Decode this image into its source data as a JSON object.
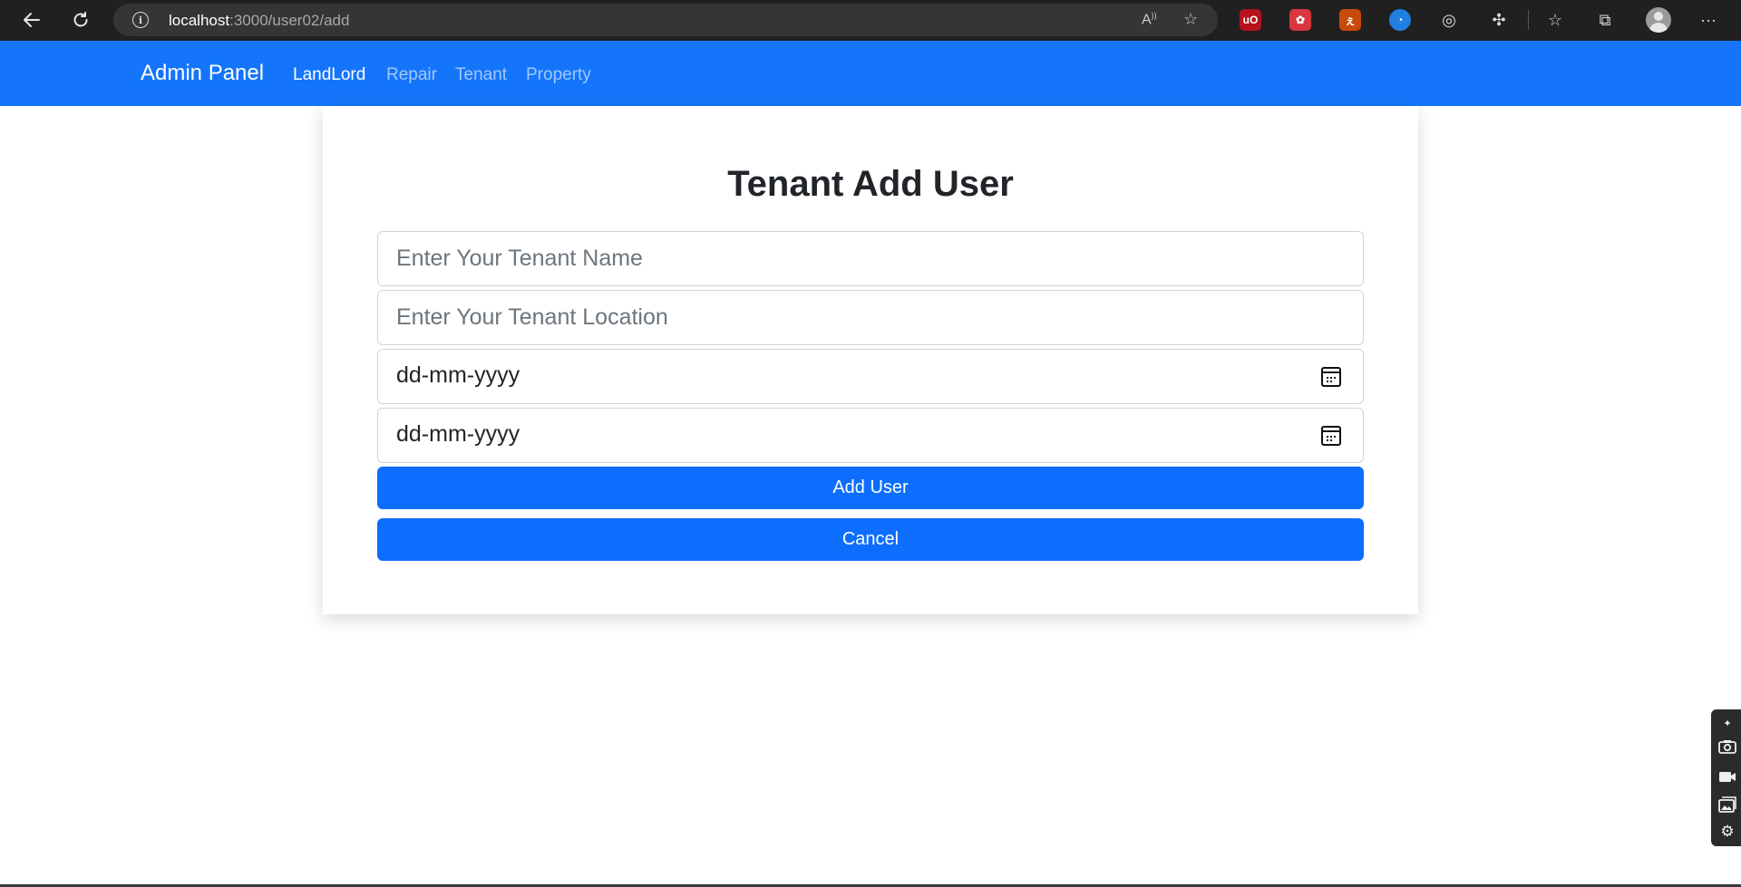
{
  "browser": {
    "url_host": "localhost",
    "url_path": ":3000/user02/add",
    "icons": {
      "back": "arrow-left",
      "reload": "reload",
      "info": "i",
      "read_aloud": "A",
      "favorite_add": "star-plus"
    },
    "extensions": [
      {
        "name": "ublock-origin",
        "color": "#b5121b",
        "glyph": "uO"
      },
      {
        "name": "extension-red",
        "color": "#d8373f",
        "glyph": "✿"
      },
      {
        "name": "extension-orange",
        "color": "#c84a0c",
        "glyph": "ぇ"
      },
      {
        "name": "extension-blue",
        "color": "#1e7fe0",
        "glyph": "◔"
      },
      {
        "name": "extension-target",
        "color": "#202020",
        "glyph": "◎"
      }
    ]
  },
  "navbar": {
    "brand": "Admin Panel",
    "links": [
      {
        "label": "LandLord",
        "active": true
      },
      {
        "label": "Repair",
        "active": false
      },
      {
        "label": "Tenant",
        "active": false
      },
      {
        "label": "Property",
        "active": false
      }
    ]
  },
  "form": {
    "title": "Tenant Add User",
    "name_placeholder": "Enter Your Tenant Name",
    "location_placeholder": "Enter Your Tenant Location",
    "date1": "dd-mm-yyyy",
    "date2": "dd-mm-yyyy",
    "submit_label": "Add User",
    "cancel_label": "Cancel"
  },
  "colors": {
    "navbar": "#1475fb",
    "button": "#0d6efd"
  }
}
